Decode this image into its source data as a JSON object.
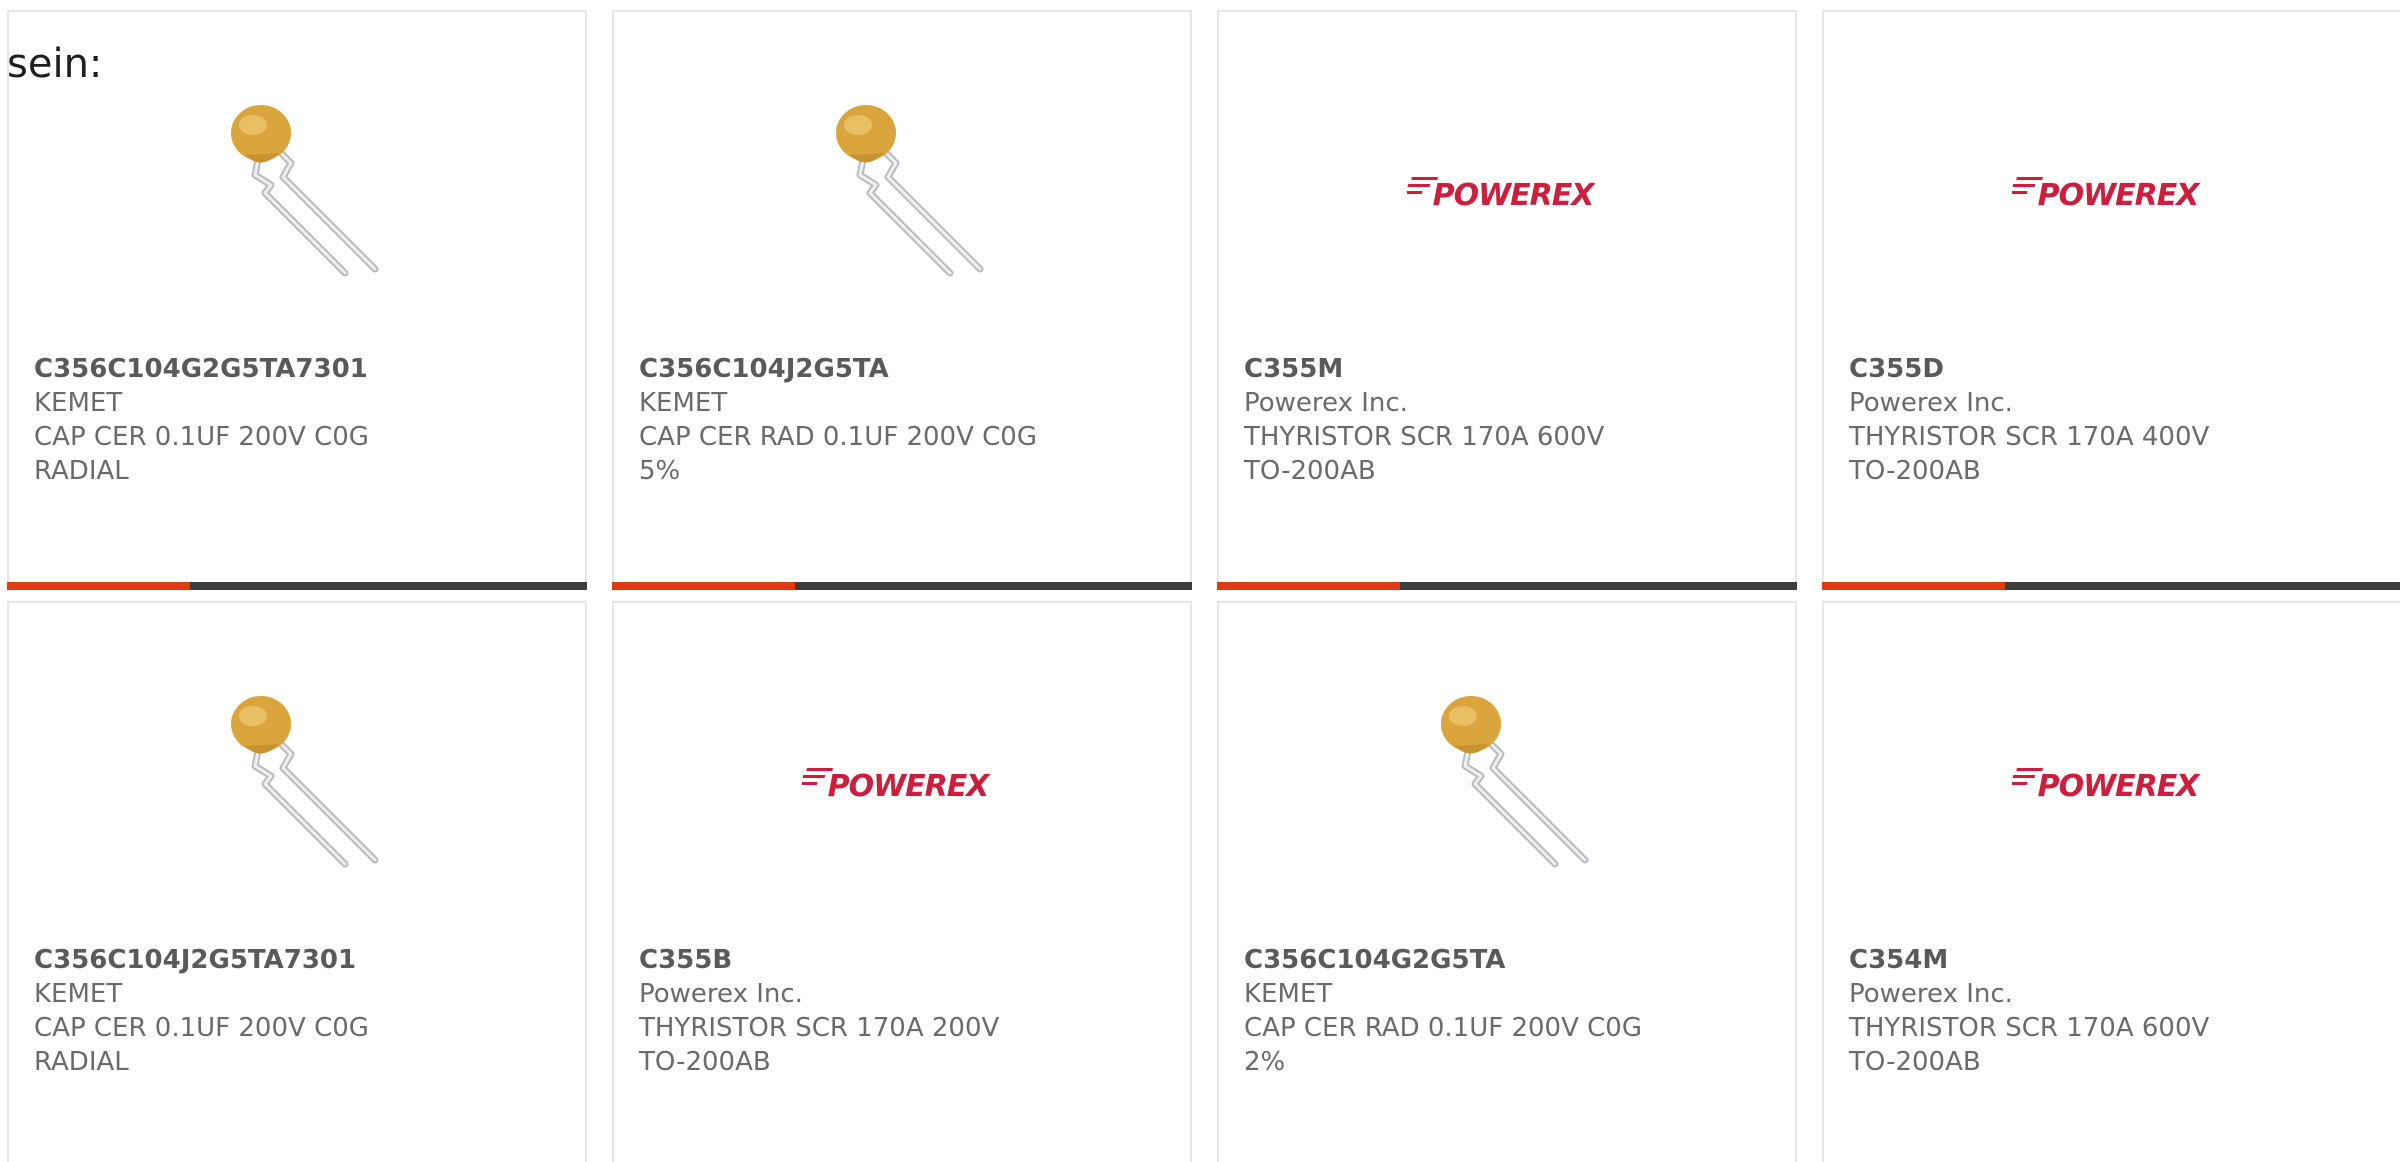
{
  "intro_text": "sein:",
  "colors": {
    "accent": "#e03a12",
    "bar": "#3d3d3d",
    "powerex_red": "#cc1f3e",
    "capacitor_body": "#d9a53c"
  },
  "products": [
    {
      "part_number": "C356C104G2G5TA7301",
      "manufacturer": "KEMET",
      "description": "CAP CER 0.1UF 200V C0G RADIAL",
      "image": "capacitor-image"
    },
    {
      "part_number": "C356C104J2G5TA",
      "manufacturer": "KEMET",
      "description": "CAP CER RAD 0.1UF 200V C0G 5%",
      "image": "capacitor-image"
    },
    {
      "part_number": "C355M",
      "manufacturer": "Powerex Inc.",
      "description": "THYRISTOR SCR 170A 600V TO-200AB",
      "image": "powerex-logo",
      "logo_text": "POWEREX"
    },
    {
      "part_number": "C355D",
      "manufacturer": "Powerex Inc.",
      "description": "THYRISTOR SCR 170A 400V TO-200AB",
      "image": "powerex-logo",
      "logo_text": "POWEREX"
    },
    {
      "part_number": "C356C104J2G5TA7301",
      "manufacturer": "KEMET",
      "description": "CAP CER 0.1UF 200V C0G RADIAL",
      "image": "capacitor-image"
    },
    {
      "part_number": "C355B",
      "manufacturer": "Powerex Inc.",
      "description": "THYRISTOR SCR 170A 200V TO-200AB",
      "image": "powerex-logo",
      "logo_text": "POWEREX"
    },
    {
      "part_number": "C356C104G2G5TA",
      "manufacturer": "KEMET",
      "description": "CAP CER RAD 0.1UF 200V C0G 2%",
      "image": "capacitor-image"
    },
    {
      "part_number": "C354M",
      "manufacturer": "Powerex Inc.",
      "description": "THYRISTOR SCR 170A 600V TO-200AB",
      "image": "powerex-logo",
      "logo_text": "POWEREX"
    }
  ]
}
